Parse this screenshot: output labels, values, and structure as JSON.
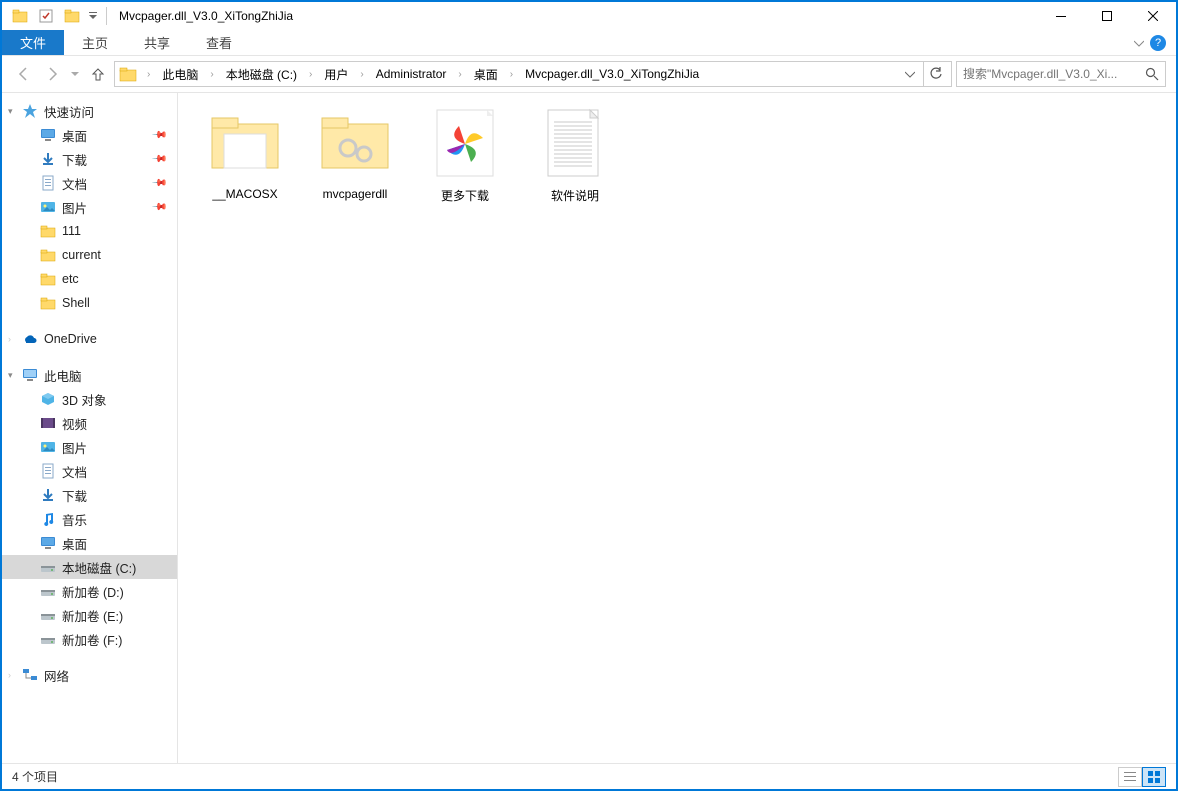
{
  "titlebar": {
    "title": "Mvcpager.dll_V3.0_XiTongZhiJia"
  },
  "ribbon": {
    "file": "文件",
    "tabs": [
      "主页",
      "共享",
      "查看"
    ]
  },
  "breadcrumbs": [
    "此电脑",
    "本地磁盘 (C:)",
    "用户",
    "Administrator",
    "桌面",
    "Mvcpager.dll_V3.0_XiTongZhiJia"
  ],
  "search": {
    "placeholder": "搜索\"Mvcpager.dll_V3.0_Xi..."
  },
  "navpane": {
    "quick_access": "快速访问",
    "quick_items": [
      {
        "label": "桌面",
        "icon": "desktop",
        "pinned": true
      },
      {
        "label": "下载",
        "icon": "downloads",
        "pinned": true
      },
      {
        "label": "文档",
        "icon": "documents",
        "pinned": true
      },
      {
        "label": "图片",
        "icon": "pictures",
        "pinned": true
      },
      {
        "label": "111",
        "icon": "folder",
        "pinned": false
      },
      {
        "label": "current",
        "icon": "folder",
        "pinned": false
      },
      {
        "label": "etc",
        "icon": "folder",
        "pinned": false
      },
      {
        "label": "Shell",
        "icon": "folder",
        "pinned": false
      }
    ],
    "onedrive": "OneDrive",
    "this_pc": "此电脑",
    "pc_items": [
      {
        "label": "3D 对象",
        "icon": "3d"
      },
      {
        "label": "视频",
        "icon": "videos"
      },
      {
        "label": "图片",
        "icon": "pictures"
      },
      {
        "label": "文档",
        "icon": "documents"
      },
      {
        "label": "下载",
        "icon": "downloads"
      },
      {
        "label": "音乐",
        "icon": "music"
      },
      {
        "label": "桌面",
        "icon": "desktop"
      },
      {
        "label": "本地磁盘 (C:)",
        "icon": "drive",
        "selected": true
      },
      {
        "label": "新加卷 (D:)",
        "icon": "drive"
      },
      {
        "label": "新加卷 (E:)",
        "icon": "drive"
      },
      {
        "label": "新加卷 (F:)",
        "icon": "drive"
      }
    ],
    "network": "网络"
  },
  "files": [
    {
      "name": "__MACOSX",
      "type": "folder-empty"
    },
    {
      "name": "mvcpagerdll",
      "type": "folder-config"
    },
    {
      "name": "更多下载",
      "type": "pinwheel"
    },
    {
      "name": "软件说明",
      "type": "text"
    }
  ],
  "statusbar": {
    "count": "4 个项目"
  }
}
